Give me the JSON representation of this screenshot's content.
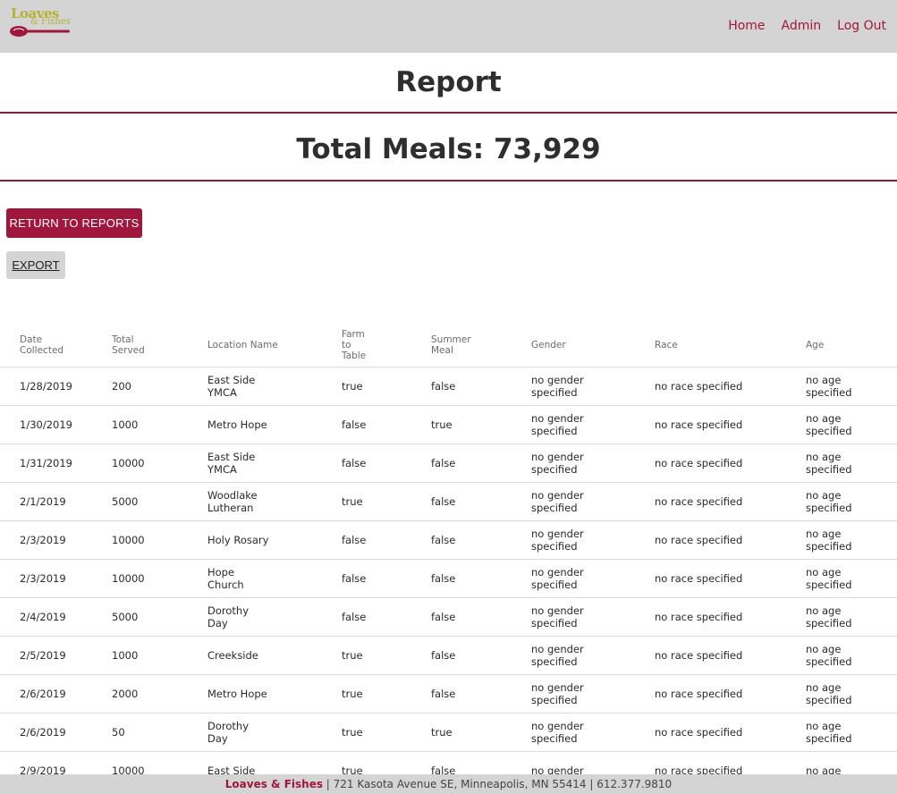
{
  "header": {
    "logo_line1": "Loaves",
    "logo_line2": "& Fishes",
    "nav": [
      {
        "label": "Home"
      },
      {
        "label": "Admin"
      },
      {
        "label": "Log Out"
      }
    ]
  },
  "page_title": "Report",
  "total_meals": "Total Meals: 73,929",
  "buttons": {
    "return_label": "RETURN TO REPORTS",
    "export_label": "EXPORT"
  },
  "table": {
    "columns": [
      "Date Collected",
      "Total Served",
      "Location Name",
      "Farm to Table",
      "Summer Meal",
      "Gender",
      "Race",
      "Age"
    ],
    "rows": [
      [
        "1/28/2019",
        "200",
        "East Side YMCA",
        "true",
        "false",
        "no gender specified",
        "no race specified",
        "no age specified"
      ],
      [
        "1/30/2019",
        "1000",
        "Metro Hope",
        "false",
        "true",
        "no gender specified",
        "no race specified",
        "no age specified"
      ],
      [
        "1/31/2019",
        "10000",
        "East Side YMCA",
        "false",
        "false",
        "no gender specified",
        "no race specified",
        "no age specified"
      ],
      [
        "2/1/2019",
        "5000",
        "Woodlake Lutheran",
        "true",
        "false",
        "no gender specified",
        "no race specified",
        "no age specified"
      ],
      [
        "2/3/2019",
        "10000",
        "Holy Rosary",
        "false",
        "false",
        "no gender specified",
        "no race specified",
        "no age specified"
      ],
      [
        "2/3/2019",
        "10000",
        "Hope Church",
        "false",
        "false",
        "no gender specified",
        "no race specified",
        "no age specified"
      ],
      [
        "2/4/2019",
        "5000",
        "Dorothy Day",
        "false",
        "false",
        "no gender specified",
        "no race specified",
        "no age specified"
      ],
      [
        "2/5/2019",
        "1000",
        "Creekside",
        "true",
        "false",
        "no gender specified",
        "no race specified",
        "no age specified"
      ],
      [
        "2/6/2019",
        "2000",
        "Metro Hope",
        "true",
        "false",
        "no gender specified",
        "no race specified",
        "no age specified"
      ],
      [
        "2/6/2019",
        "50",
        "Dorothy Day",
        "true",
        "true",
        "no gender specified",
        "no race specified",
        "no age specified"
      ],
      [
        "2/9/2019",
        "10000",
        "East Side",
        "true",
        "false",
        "no gender",
        "no race specified",
        "no age"
      ]
    ]
  },
  "footer": {
    "brand": "Loaves & Fishes",
    "address": " | 721 Kasota Avenue SE, Minneapolis, MN 55414 | 612.377.9810"
  },
  "colors": {
    "accent": "#a0173d",
    "header_bg": "#d4d4d4",
    "logo_gold": "#b5b231"
  }
}
